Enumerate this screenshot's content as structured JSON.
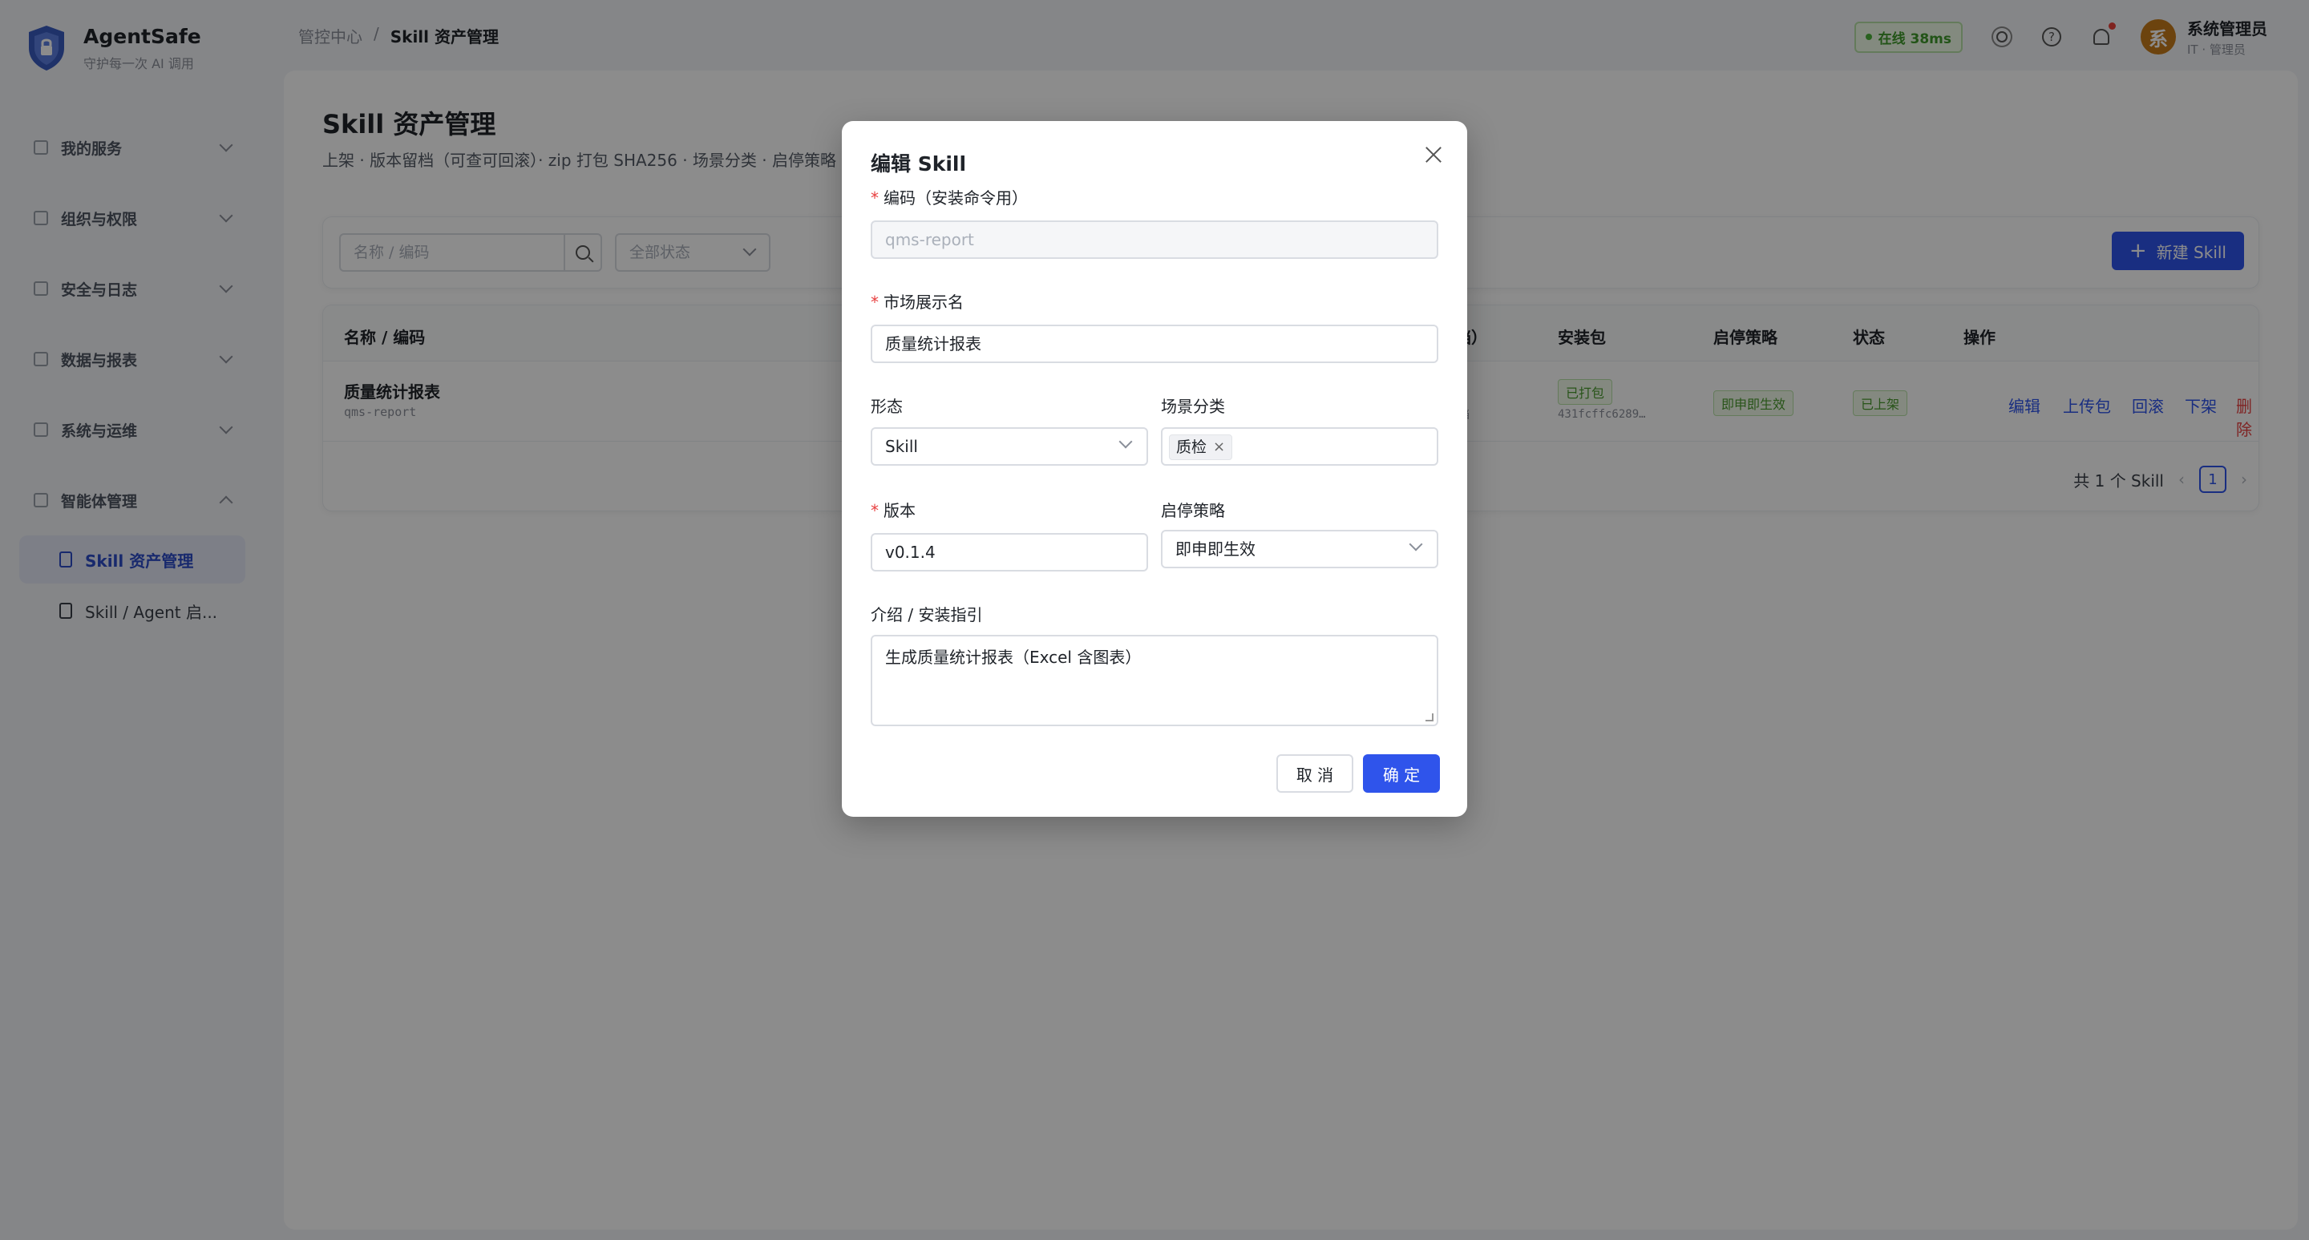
{
  "brand": {
    "name": "AgentSafe",
    "subtitle": "守护每一次 AI 调用"
  },
  "sidebar": {
    "groups": [
      {
        "label": "我的服务"
      },
      {
        "label": "组织与权限"
      },
      {
        "label": "安全与日志"
      },
      {
        "label": "数据与报表"
      },
      {
        "label": "系统与运维"
      },
      {
        "label": "智能体管理"
      }
    ],
    "sub_items": [
      {
        "label": "Skill 资产管理"
      },
      {
        "label": "Skill / Agent 启..."
      }
    ]
  },
  "breadcrumb": {
    "root": "管控中心",
    "sep": "/",
    "current": "Skill 资产管理"
  },
  "topbar": {
    "online": "在线 38ms",
    "user_name": "系统管理员",
    "user_role": "IT · 管理员",
    "avatar_char": "系"
  },
  "page": {
    "title": "Skill 资产管理",
    "description": "上架 · 版本留档（可查可回滚）· zip 打包 SHA256 · 场景分类 · 启停策略"
  },
  "toolbar": {
    "search_placeholder": "名称 / 编码",
    "status_placeholder": "全部状态",
    "new_button": "新建 Skill"
  },
  "table": {
    "headers": {
      "name": "名称 / 编码",
      "archive": "档）",
      "package": "安装包",
      "policy": "启停策略",
      "status": "状态",
      "ops": "操作"
    },
    "rows": [
      {
        "name": "质量统计报表",
        "code": "qms-report",
        "archive_hint": "档",
        "package_tag": "已打包",
        "package_hash": "431fcffc6289…",
        "policy": "即申即生效",
        "status": "已上架",
        "ops": [
          "编辑",
          "上传包",
          "回滚",
          "下架",
          "删除"
        ]
      }
    ],
    "total": "共 1 个 Skill",
    "page": "1"
  },
  "modal": {
    "title": "编辑 Skill",
    "code_label": "编码（安装命令用）",
    "code_value": "qms-report",
    "display_label": "市场展示名",
    "display_value": "质量统计报表",
    "form_label": "形态",
    "form_value": "Skill",
    "scene_label": "场景分类",
    "scene_tag": "质检",
    "version_label": "版本",
    "version_value": "v0.1.4",
    "policy_label": "启停策略",
    "policy_value": "即申即生效",
    "intro_label": "介绍 / 安装指引",
    "intro_value": "生成质量统计报表（Excel 含图表）",
    "cancel": "取 消",
    "ok": "确 定",
    "required_mark": "*"
  },
  "colors": {
    "primary": "#2f54eb",
    "danger": "#e84040",
    "success": "#4a9a2f"
  }
}
